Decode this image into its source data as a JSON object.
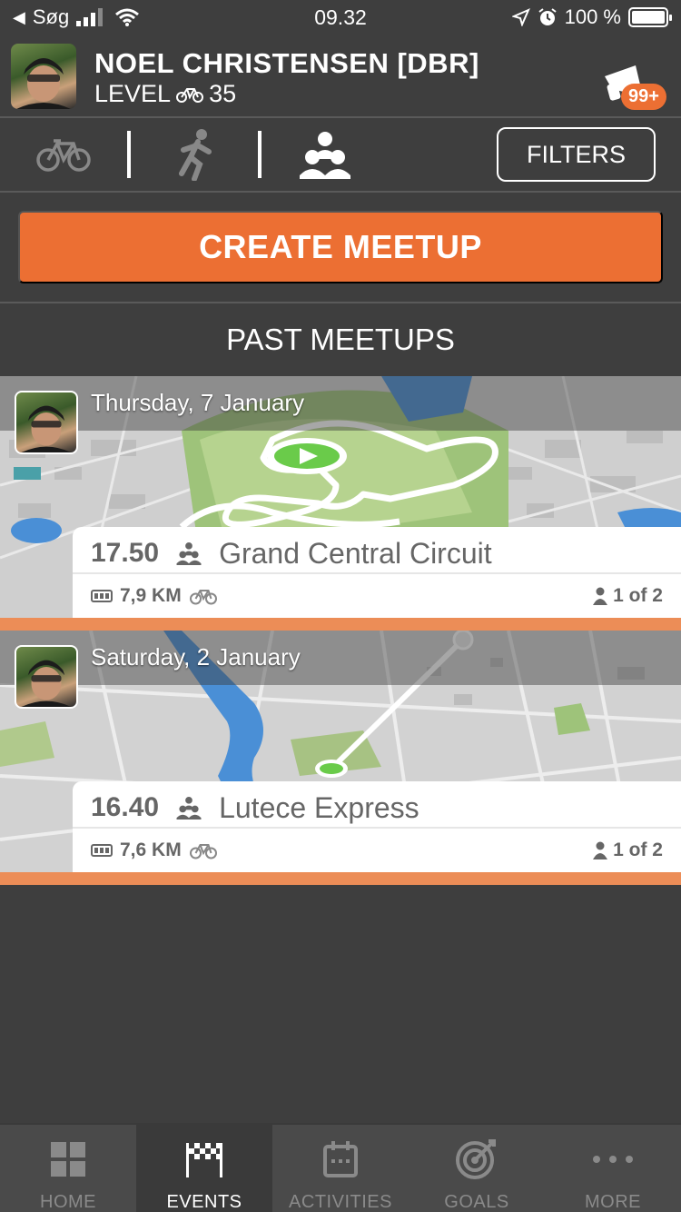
{
  "status_bar": {
    "back_app": "Søg",
    "time": "09.32",
    "battery": "100 %"
  },
  "profile": {
    "name": "NOEL CHRISTENSEN [DBR]",
    "level_label": "LEVEL",
    "level": "35",
    "notification_badge": "99+"
  },
  "filters_label": "FILTERS",
  "create_label": "CREATE MEETUP",
  "section_title": "PAST MEETUPS",
  "meetups": [
    {
      "date": "Thursday, 7 January",
      "time": "17.50",
      "route": "Grand Central Circuit",
      "distance": "7,9 KM",
      "participants": "1 of 2"
    },
    {
      "date": "Saturday, 2 January",
      "time": "16.40",
      "route": "Lutece Express",
      "distance": "7,6 KM",
      "participants": "1 of 2"
    }
  ],
  "bottom_nav": [
    {
      "label": "HOME",
      "icon": "grid-icon"
    },
    {
      "label": "EVENTS",
      "icon": "checkered-flag-icon"
    },
    {
      "label": "ACTIVITIES",
      "icon": "calendar-icon"
    },
    {
      "label": "GOALS",
      "icon": "target-icon"
    },
    {
      "label": "MORE",
      "icon": "ellipsis-icon"
    }
  ],
  "colors": {
    "accent": "#ec6f33",
    "background": "#3e3e3e",
    "nav_bg": "#4a4a4a"
  }
}
